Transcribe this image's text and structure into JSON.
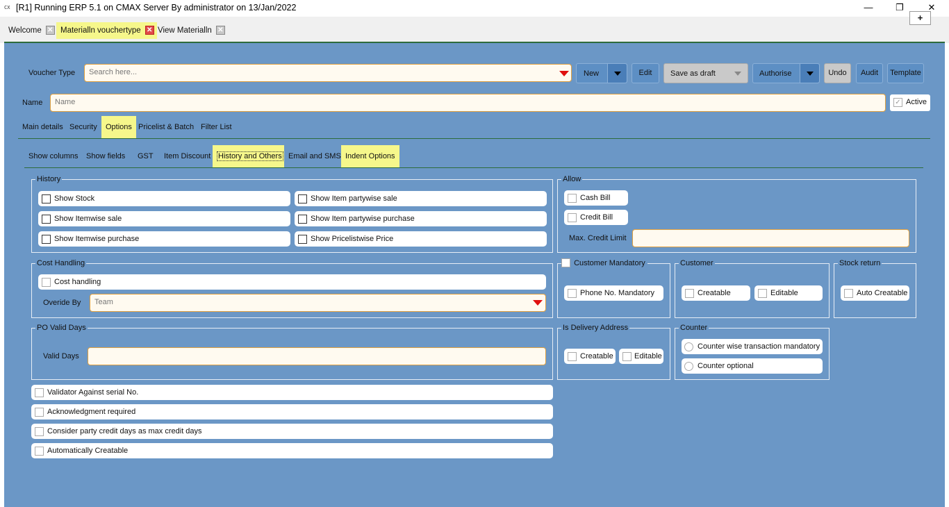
{
  "window": {
    "icon_text": "CX",
    "title": "[R1] Running ERP 5.1 on CMAX Server By administrator on 13/Jan/2022",
    "minimize": "—",
    "restore": "❐",
    "close": "✕"
  },
  "tabs": [
    {
      "label": "Welcome",
      "close": "✕"
    },
    {
      "label": "Materialln vouchertype",
      "close": "✕"
    },
    {
      "label": "View Materialln",
      "close": "✕"
    }
  ],
  "plus_label": "+",
  "toolbar": {
    "voucher_type_label": "Voucher Type",
    "voucher_type_placeholder": "Search here...",
    "new_label": "New",
    "edit_label": "Edit",
    "save_draft_label": "Save as draft",
    "authorise_label": "Authorise",
    "undo_label": "Undo",
    "audit_label": "Audit",
    "template_label": "Template"
  },
  "name_row": {
    "label": "Name",
    "placeholder": "Name",
    "active_label": "Active",
    "active_checked": true
  },
  "main_tabs": [
    "Main details",
    "Security",
    "Options",
    "Pricelist & Batch",
    "Filter List"
  ],
  "sub_tabs": [
    "Show columns",
    "Show fields",
    "GST",
    "Item Discount",
    "History and Others",
    "Email and SMS",
    "Indent Options"
  ],
  "history": {
    "title": "History",
    "items": [
      "Show Stock",
      "Show Item partywise sale",
      "Show Itemwise sale",
      "Show Item partywise purchase",
      "Show Itemwise purchase",
      "Show Pricelistwise Price"
    ]
  },
  "allow": {
    "title": "Allow",
    "cash_bill": "Cash Bill",
    "credit_bill": "Credit Bill",
    "max_credit_limit": "Max. Credit Limit"
  },
  "cost_handling": {
    "title": "Cost Handling",
    "checkbox": "Cost handling",
    "override_label": "Overide By",
    "override_placeholder": "Team"
  },
  "customer_mandatory": {
    "title": "Customer Mandatory",
    "phone": "Phone No. Mandatory"
  },
  "customer": {
    "title": "Customer",
    "creatable": "Creatable",
    "editable": "Editable"
  },
  "stock_return": {
    "title": "Stock return",
    "auto_creatable": "Auto Creatable"
  },
  "po_valid_days": {
    "title": "PO Valid Days",
    "label": "Valid Days"
  },
  "delivery_address": {
    "title": "Is Delivery Address",
    "creatable": "Creatable",
    "editable": "Editable"
  },
  "counter": {
    "title": "Counter",
    "option1": "Counter wise transaction mandatory",
    "option2": "Counter optional"
  },
  "bottom_options": [
    "Validator Against serial No.",
    "Acknowledgment required",
    "Consider party credit days as max credit days",
    "Automatically Creatable"
  ],
  "colors": {
    "panel": "#6b97c6",
    "highlight": "#f6f78b",
    "divider": "#2d6b3b",
    "input_border": "#e0a040",
    "dropdown_arrow": "#e01010"
  }
}
